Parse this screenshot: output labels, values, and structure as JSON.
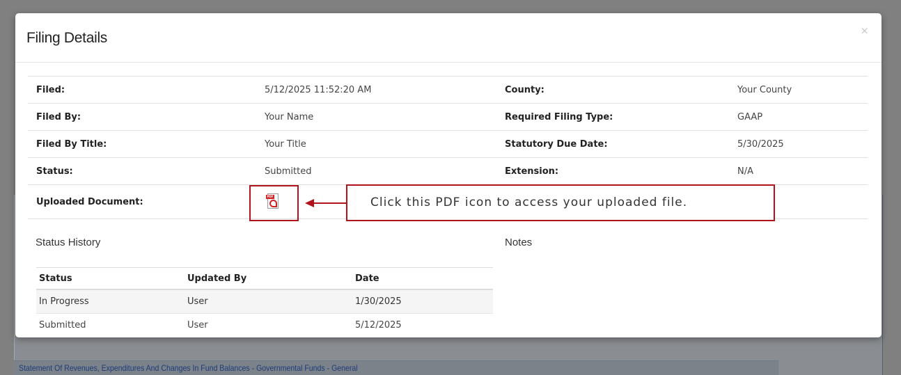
{
  "background": {
    "row_text": "Statement Of Revenues, Expenditures And Changes In Fund Balances - Governmental Funds - General"
  },
  "modal": {
    "title": "Filing Details",
    "close_glyph": "×",
    "details": [
      {
        "label": "Filed:",
        "value": "5/12/2025 11:52:20 AM",
        "label2": "County:",
        "value2": "Your County"
      },
      {
        "label": "Filed By:",
        "value": "Your Name",
        "label2": "Required Filing Type:",
        "value2": "GAAP"
      },
      {
        "label": "Filed By Title:",
        "value": "Your Title",
        "label2": "Statutory Due Date:",
        "value2": "5/30/2025"
      },
      {
        "label": "Status:",
        "value": "Submitted",
        "label2": "Extension:",
        "value2": "N/A"
      },
      {
        "label": "Uploaded Document:",
        "icon": "pdf-icon"
      }
    ],
    "callout_text": "Click this PDF icon to access your uploaded file.",
    "status_history": {
      "heading": "Status History",
      "columns": [
        "Status",
        "Updated By",
        "Date"
      ],
      "rows": [
        [
          "In Progress",
          "User",
          "1/30/2025"
        ],
        [
          "Submitted",
          "User",
          "5/12/2025"
        ]
      ]
    },
    "notes_heading": "Notes"
  },
  "colors": {
    "annotation": "#b0131c",
    "pdf_red": "#d32020",
    "overlay": "#7b7b7b"
  }
}
